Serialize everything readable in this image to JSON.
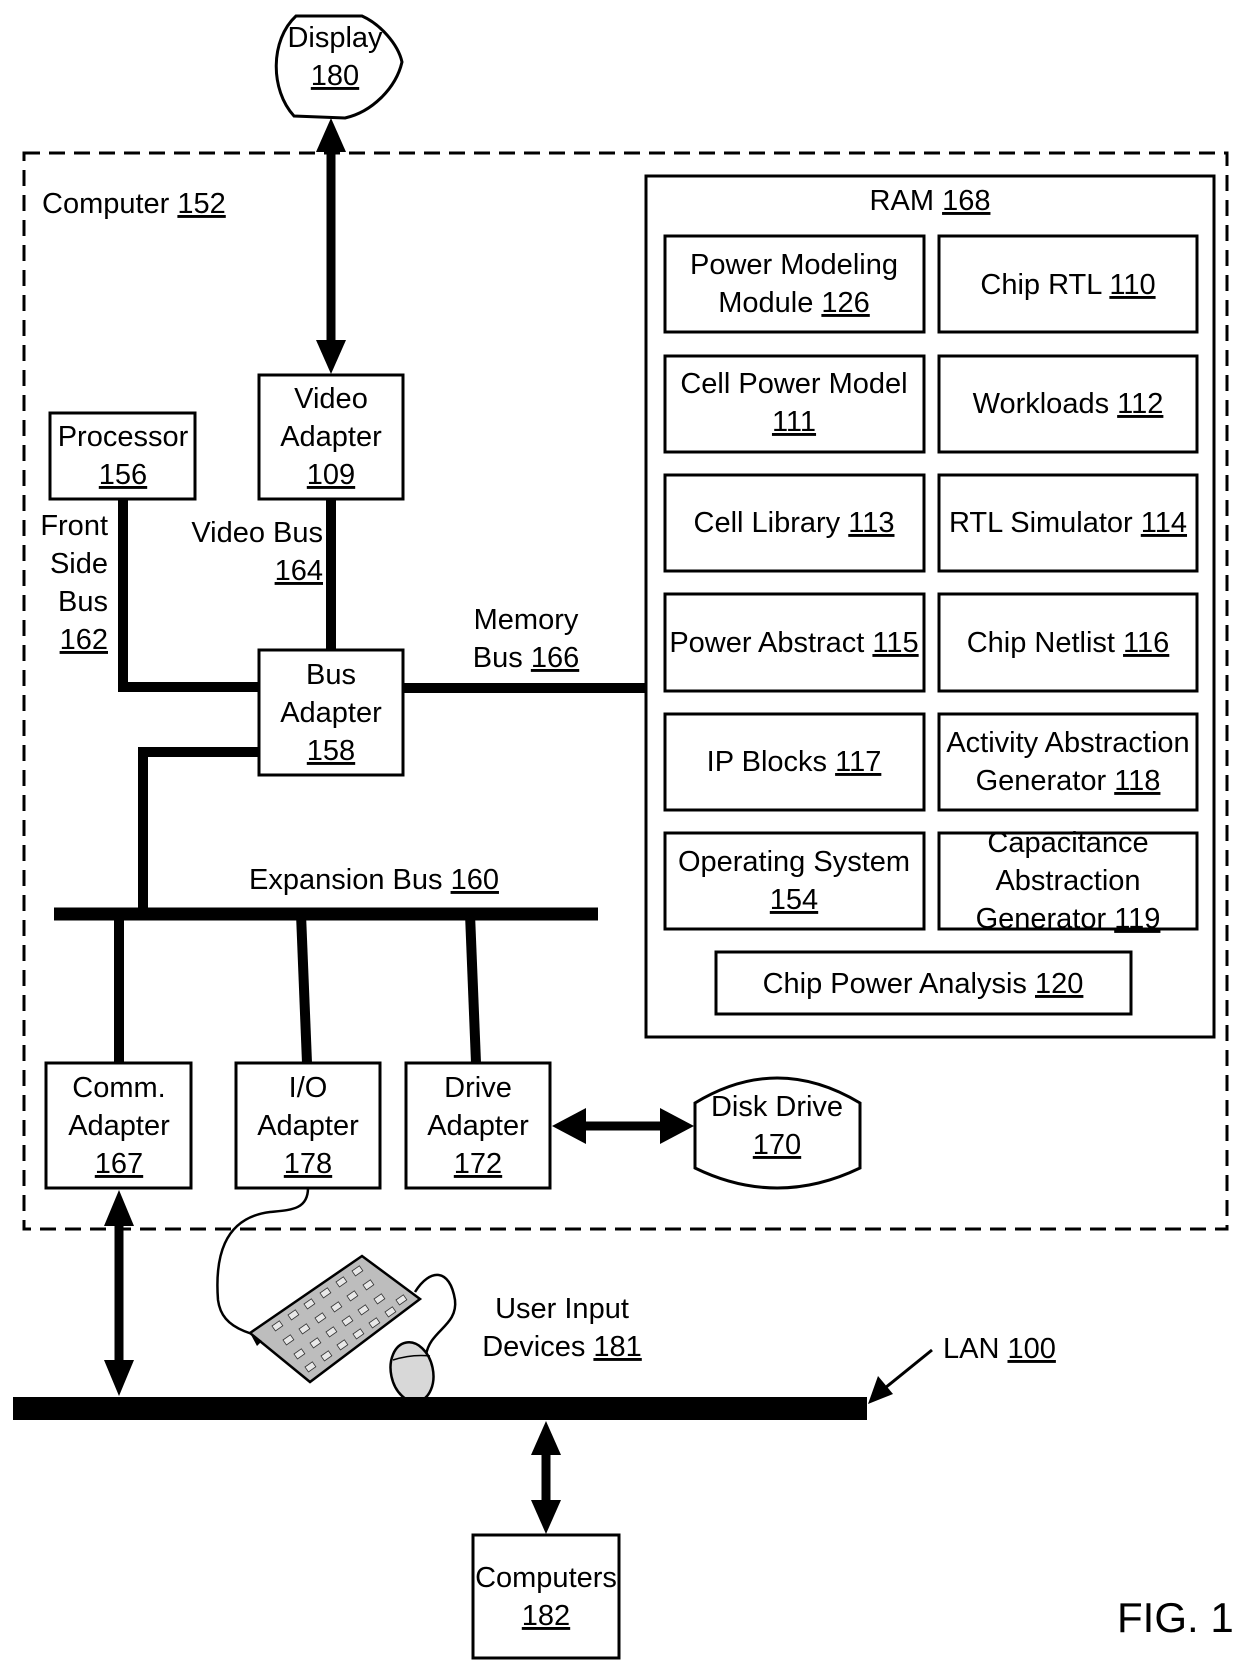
{
  "figure_label": "FIG. 1",
  "computer": {
    "label": "Computer",
    "ref": "152"
  },
  "display": {
    "label": "Display",
    "ref": "180"
  },
  "video_adapter": {
    "line1": "Video",
    "line2": "Adapter",
    "ref": "109"
  },
  "processor": {
    "label": "Processor",
    "ref": "156"
  },
  "front_side_bus": {
    "line1": "Front",
    "line2": "Side",
    "line3": "Bus",
    "ref": "162"
  },
  "video_bus": {
    "label": "Video Bus",
    "ref": "164"
  },
  "bus_adapter": {
    "line1": "Bus",
    "line2": "Adapter",
    "ref": "158"
  },
  "memory_bus": {
    "line1": "Memory",
    "line2": "Bus",
    "ref": "166"
  },
  "expansion_bus": {
    "label": "Expansion Bus",
    "ref": "160"
  },
  "ram": {
    "label": "RAM",
    "ref": "168",
    "modules": [
      {
        "line1": "Power Modeling",
        "line2": "Module",
        "ref": "126"
      },
      {
        "line1": "Chip RTL",
        "ref": "110"
      },
      {
        "line1": "Cell Power Model",
        "ref": "111"
      },
      {
        "line1": "Workloads",
        "ref": "112"
      },
      {
        "line1": "Cell Library",
        "ref": "113"
      },
      {
        "line1": "RTL Simulator",
        "ref": "114"
      },
      {
        "line1": "Power Abstract",
        "ref": "115"
      },
      {
        "line1": "Chip Netlist",
        "ref": "116"
      },
      {
        "line1": "IP Blocks",
        "ref": "117"
      },
      {
        "line1": "Activity Abstraction",
        "line2": "Generator",
        "ref": "118"
      },
      {
        "line1": "Operating System",
        "ref": "154"
      },
      {
        "line1": "Capacitance",
        "line2": "Abstraction",
        "line3": "Generator",
        "ref": "119"
      }
    ],
    "chip_power_analysis": {
      "label": "Chip Power Analysis",
      "ref": "120"
    }
  },
  "comm_adapter": {
    "line1": "Comm.",
    "line2": "Adapter",
    "ref": "167"
  },
  "io_adapter": {
    "line1": "I/O",
    "line2": "Adapter",
    "ref": "178"
  },
  "drive_adapter": {
    "line1": "Drive",
    "line2": "Adapter",
    "ref": "172"
  },
  "disk_drive": {
    "label": "Disk Drive",
    "ref": "170"
  },
  "user_input_devices": {
    "line1": "User Input",
    "line2": "Devices",
    "ref": "181"
  },
  "lan": {
    "label": "LAN",
    "ref": "100"
  },
  "computers": {
    "label": "Computers",
    "ref": "182"
  }
}
